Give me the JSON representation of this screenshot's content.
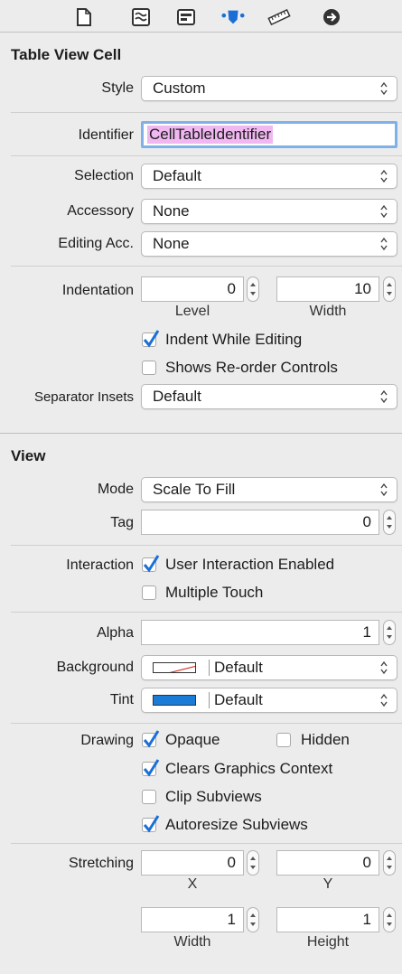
{
  "toolbar": {
    "icons": [
      "file-icon",
      "quick-help-icon",
      "identity-icon",
      "attributes-icon",
      "size-ruler-icon",
      "connections-arrow-icon"
    ]
  },
  "table_view_cell": {
    "title": "Table View Cell",
    "style_label": "Style",
    "style_value": "Custom",
    "identifier_label": "Identifier",
    "identifier_value": "CellTableIdentifier",
    "selection_label": "Selection",
    "selection_value": "Default",
    "accessory_label": "Accessory",
    "accessory_value": "None",
    "editing_acc_label": "Editing Acc.",
    "editing_acc_value": "None",
    "indentation_label": "Indentation",
    "indentation_level": "0",
    "indentation_width": "10",
    "level_label": "Level",
    "width_label": "Width",
    "indent_while_editing": "Indent While Editing",
    "indent_while_editing_checked": true,
    "shows_reorder": "Shows Re-order Controls",
    "shows_reorder_checked": false,
    "separator_label": "Separator Insets",
    "separator_value": "Default"
  },
  "view": {
    "title": "View",
    "mode_label": "Mode",
    "mode_value": "Scale To Fill",
    "tag_label": "Tag",
    "tag_value": "0",
    "interaction_label": "Interaction",
    "user_interaction": "User Interaction Enabled",
    "user_interaction_checked": true,
    "multiple_touch": "Multiple Touch",
    "multiple_touch_checked": false,
    "alpha_label": "Alpha",
    "alpha_value": "1",
    "background_label": "Background",
    "background_value": "Default",
    "tint_label": "Tint",
    "tint_value": "Default",
    "tint_color": "#1a7cd6",
    "drawing_label": "Drawing",
    "opaque": "Opaque",
    "opaque_checked": true,
    "hidden": "Hidden",
    "hidden_checked": false,
    "clears_graphics": "Clears Graphics Context",
    "clears_graphics_checked": true,
    "clip_subviews": "Clip Subviews",
    "clip_subviews_checked": false,
    "autoresize": "Autoresize Subviews",
    "autoresize_checked": true,
    "stretching_label": "Stretching",
    "stretch_x": "0",
    "stretch_y": "0",
    "stretch_width": "1",
    "stretch_height": "1",
    "x_label": "X",
    "y_label": "Y",
    "width_label": "Width",
    "height_label": "Height"
  },
  "colors": {
    "accent": "#1a6fd6",
    "selection_highlight": "#f0b7f1",
    "focus_ring": "#7fb1e8"
  }
}
